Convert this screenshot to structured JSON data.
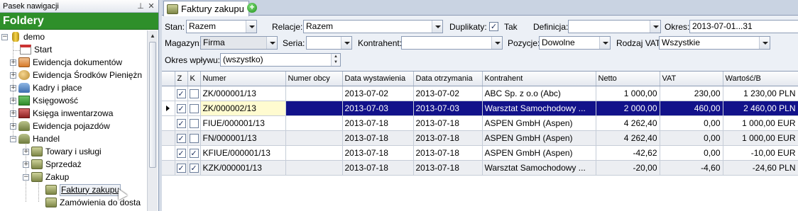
{
  "nav": {
    "header_title": "Pasek nawigacji",
    "pin_glyph": "⊥",
    "close_glyph": "✕",
    "title": "Foldery",
    "tree": {
      "root": "demo",
      "start": "Start",
      "ewidencja_dokumentow": "Ewidencja dokumentów",
      "ewidencja_srodkow": "Ewidencja Środków Pieniężn",
      "kadry": "Kadry i płace",
      "ksiegowosc": "Księgowość",
      "ksiega": "Księga inwentarzowa",
      "ewidencja_pojazdow": "Ewidencja pojazdów",
      "handel": "Handel",
      "towary": "Towary i usługi",
      "sprzedaz": "Sprzedaż",
      "zakup": "Zakup",
      "faktury_zakupu": "Faktury zakupu",
      "zamowienia": "Zamówienia do dosta"
    },
    "expander_plus": "+",
    "expander_minus": "−"
  },
  "tabs": {
    "active_label": "Faktury zakupu",
    "add_glyph": "+"
  },
  "filters": {
    "stan_label": "Stan:",
    "stan_value": "Razem",
    "relacje_label": "Relacje:",
    "relacje_value": "Razem",
    "duplikaty_label": "Duplikaty:",
    "duplikaty_checked": "✓",
    "duplikaty_value": "Tak",
    "definicja_label": "Definicja:",
    "definicja_value": "",
    "okres_label": "Okres:",
    "okres_value": "2013-07-01...31",
    "magazyn_label": "Magazyn:",
    "magazyn_value": "Firma",
    "seria_label": "Seria:",
    "seria_value": "",
    "kontrahent_label": "Kontrahent:",
    "kontrahent_value": "",
    "pozycje_label": "Pozycje:",
    "pozycje_value": "Dowolne",
    "rodzaj_vat_label": "Rodzaj VAT:",
    "rodzaj_vat_value": "Wszystkie",
    "okres_wplywu_label": "Okres wpływu:",
    "okres_wplywu_value": "(wszystko)",
    "spin_up": "▲",
    "spin_down": "▼"
  },
  "grid": {
    "columns": [
      "Z",
      "K",
      "Numer",
      "Numer obcy",
      "Data wystawienia",
      "Data otrzymania",
      "Kontrahent",
      "Netto",
      "VAT",
      "Wartość/B"
    ],
    "check_glyph": "✓",
    "rows": [
      {
        "z": true,
        "k": false,
        "numer": "ZK/000001/13",
        "numer_obcy": "",
        "data_wyst": "2013-07-02",
        "data_otrz": "2013-07-02",
        "kontrahent": "ABC Sp. z o.o (Abc)",
        "netto": "1 000,00",
        "vat": "230,00",
        "wartosc": "1 230,00 PLN",
        "selected": false
      },
      {
        "z": true,
        "k": false,
        "numer": "ZK/000002/13",
        "numer_obcy": "",
        "data_wyst": "2013-07-03",
        "data_otrz": "2013-07-03",
        "kontrahent": "Warsztat Samochodowy ...",
        "netto": "2 000,00",
        "vat": "460,00",
        "wartosc": "2 460,00 PLN",
        "selected": true
      },
      {
        "z": true,
        "k": false,
        "numer": "FIUE/000001/13",
        "numer_obcy": "",
        "data_wyst": "2013-07-18",
        "data_otrz": "2013-07-18",
        "kontrahent": "ASPEN GmbH (Aspen)",
        "netto": "4 262,40",
        "vat": "0,00",
        "wartosc": "1 000,00 EUR",
        "selected": false
      },
      {
        "z": true,
        "k": false,
        "numer": "FN/000001/13",
        "numer_obcy": "",
        "data_wyst": "2013-07-18",
        "data_otrz": "2013-07-18",
        "kontrahent": "ASPEN GmbH (Aspen)",
        "netto": "4 262,40",
        "vat": "0,00",
        "wartosc": "1 000,00 EUR",
        "selected": false
      },
      {
        "z": true,
        "k": true,
        "numer": "KFIUE/000001/13",
        "numer_obcy": "",
        "data_wyst": "2013-07-18",
        "data_otrz": "2013-07-18",
        "kontrahent": "ASPEN GmbH (Aspen)",
        "netto": "-42,62",
        "vat": "0,00",
        "wartosc": "-10,00 EUR",
        "selected": false
      },
      {
        "z": true,
        "k": true,
        "numer": "KZK/000001/13",
        "numer_obcy": "",
        "data_wyst": "2013-07-18",
        "data_otrz": "2013-07-18",
        "kontrahent": "Warsztat Samochodowy ...",
        "netto": "-20,00",
        "vat": "-4,60",
        "wartosc": "-24,60 PLN",
        "selected": false
      }
    ]
  },
  "colors": {
    "nav_title_bg": "#2e8f2a",
    "selected_row_bg": "#12128a"
  }
}
